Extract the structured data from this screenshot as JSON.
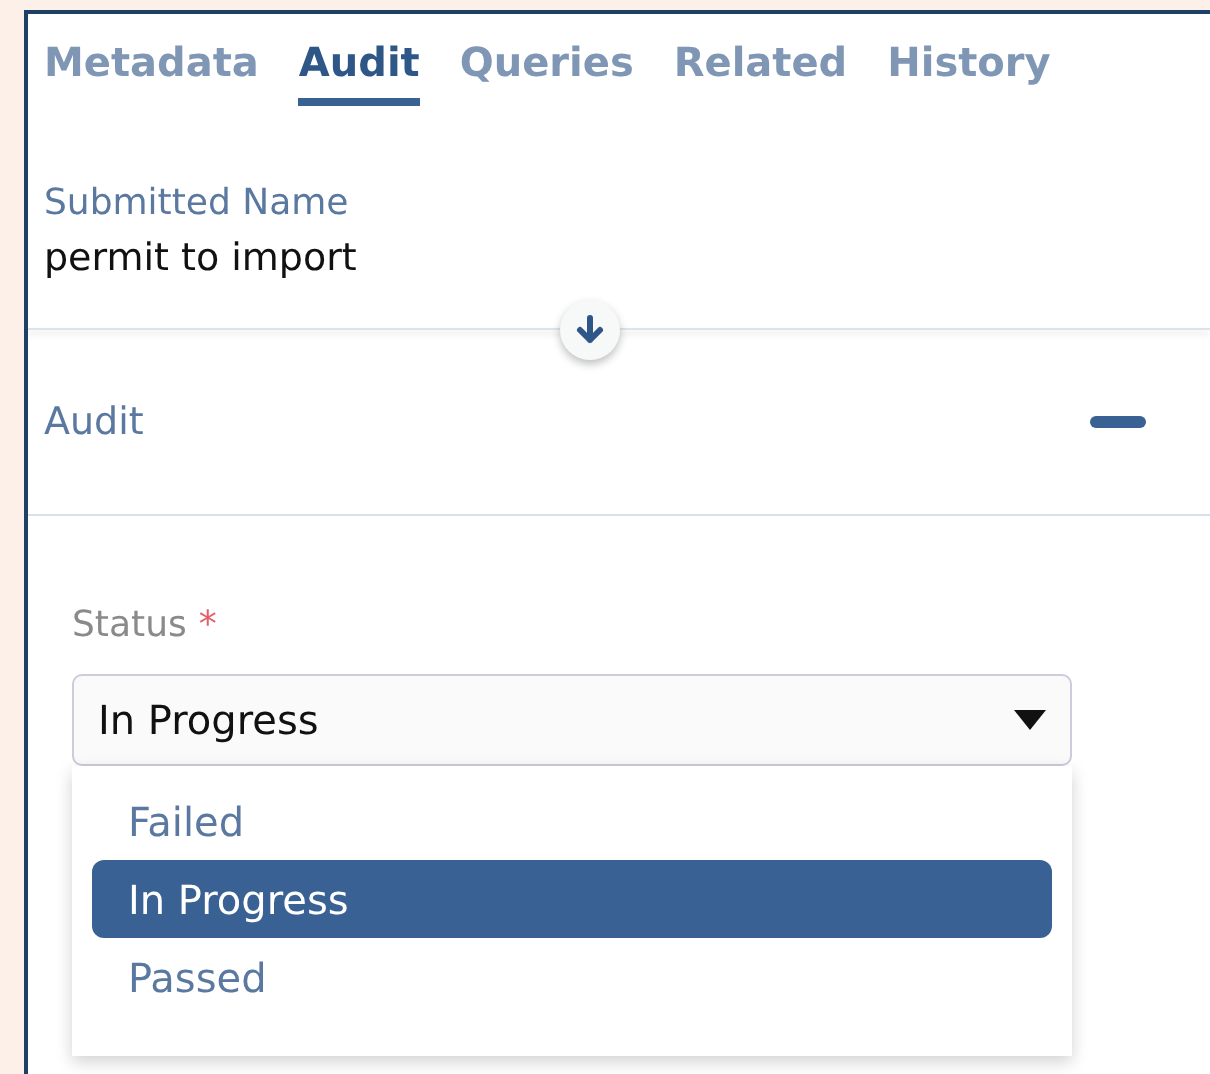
{
  "tabs": [
    {
      "label": "Metadata",
      "selected": false
    },
    {
      "label": "Audit",
      "selected": true
    },
    {
      "label": "Queries",
      "selected": false
    },
    {
      "label": "Related",
      "selected": false
    },
    {
      "label": "History",
      "selected": false
    }
  ],
  "submitted_name": {
    "label": "Submitted Name",
    "value": "permit to import"
  },
  "section": {
    "title": "Audit",
    "expanded": true
  },
  "status_field": {
    "label": "Status",
    "required_mark": "*",
    "value": "In Progress"
  },
  "options": [
    {
      "label": "Failed",
      "selected": false
    },
    {
      "label": "In Progress",
      "selected": true
    },
    {
      "label": "Passed",
      "selected": false
    }
  ]
}
